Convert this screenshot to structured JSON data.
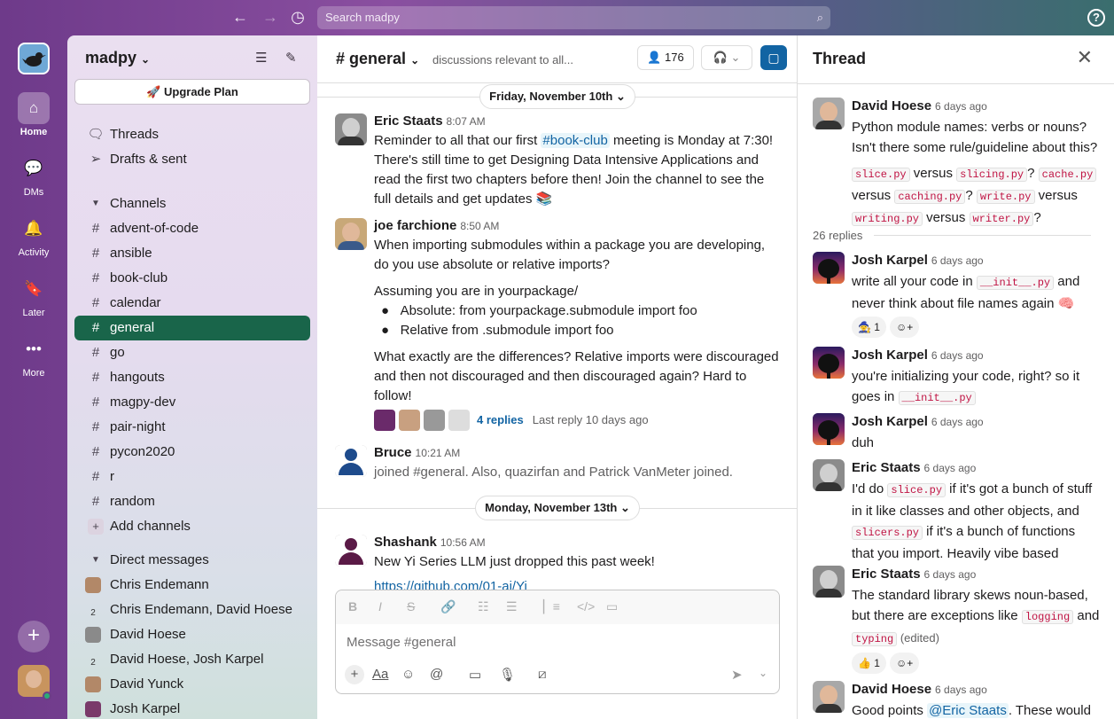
{
  "search": {
    "placeholder": "Search madpy"
  },
  "rail": {
    "items": [
      {
        "label": "Home",
        "icon": "home-icon"
      },
      {
        "label": "DMs",
        "icon": "dms-icon"
      },
      {
        "label": "Activity",
        "icon": "bell-icon"
      },
      {
        "label": "Later",
        "icon": "bookmark-icon"
      },
      {
        "label": "More",
        "icon": "more-icon"
      }
    ]
  },
  "sidebar": {
    "workspace": "madpy",
    "upgrade": "Upgrade Plan",
    "threads": "Threads",
    "drafts": "Drafts & sent",
    "channels_header": "Channels",
    "channels": [
      "advent-of-code",
      "ansible",
      "book-club",
      "calendar",
      "general",
      "go",
      "hangouts",
      "magpy-dev",
      "pair-night",
      "pycon2020",
      "r",
      "random"
    ],
    "add_channels": "Add channels",
    "dm_header": "Direct messages",
    "dms": [
      {
        "name": "Chris Endemann",
        "count": ""
      },
      {
        "name": "Chris Endemann, David Hoese",
        "count": "2"
      },
      {
        "name": "David Hoese",
        "count": ""
      },
      {
        "name": "David Hoese, Josh Karpel",
        "count": "2"
      },
      {
        "name": "David Yunck",
        "count": ""
      },
      {
        "name": "Josh Karpel",
        "count": ""
      }
    ]
  },
  "channel": {
    "name": "# general",
    "topic": "discussions relevant to all...",
    "members": "176"
  },
  "messages": {
    "day1": "Friday, November 10th",
    "day2": "Monday, November 13th",
    "m1": {
      "author": "Eric Staats",
      "time": "8:07 AM",
      "text_a": "Reminder to all that our first ",
      "mention": "#book-club",
      "text_b": " meeting is Monday at 7:30! There's still time to get Designing Data Intensive Applications and read the first two chapters before then! Join the channel to see the full details and get updates 📚"
    },
    "m2": {
      "author": "joe farchione",
      "time": "8:50 AM",
      "p1": "When importing submodules within a package you are developing, do you use absolute or relative imports?",
      "p2": "Assuming you are in yourpackage/",
      "b1": "Absolute: from yourpackage.submodule import foo",
      "b2": "Relative from .submodule import foo",
      "p3": "What exactly are the differences? Relative imports were discouraged and then not discouraged and then discouraged again? Hard to follow!",
      "replies": "4 replies",
      "last_reply": "Last reply 10 days ago"
    },
    "m3": {
      "author": "Bruce",
      "time": "10:21 AM",
      "text": "joined #general. Also, quazirfan and Patrick VanMeter joined."
    },
    "m4": {
      "author": "Shashank",
      "time": "10:56 AM",
      "text": "New Yi Series LLM just dropped this past week!",
      "link": "https://github.com/01-ai/Yi"
    }
  },
  "composer": {
    "placeholder": "Message #general"
  },
  "thread": {
    "title": "Thread",
    "replies_count": "26 replies",
    "root": {
      "author": "David Hoese",
      "time": "6 days ago",
      "text": "Python module names: verbs or nouns? Isn't there some rule/guideline about this?",
      "c1": "slice.py",
      "w1": " versus ",
      "c2": "slicing.py",
      "w2": "? ",
      "c3": "cache.py",
      "w3": " versus ",
      "c4": "caching.py",
      "w4": "? ",
      "c5": "write.py",
      "w5": " versus ",
      "c6": "writing.py",
      "w6": " versus ",
      "c7": "writer.py",
      "w7": "?"
    },
    "r1": {
      "author": "Josh Karpel",
      "time": "6 days ago",
      "a": "write all your code in ",
      "code": "__init__.py",
      "b": " and never think about file names again 🧠",
      "react": "🧙 1"
    },
    "r2": {
      "author": "Josh Karpel",
      "time": "6 days ago",
      "a": "you're initializing your code, right? so it goes in ",
      "code": "__init__.py"
    },
    "r3": {
      "author": "Josh Karpel",
      "time": "6 days ago",
      "a": "duh"
    },
    "r4": {
      "author": "Eric Staats",
      "time": "6 days ago",
      "a": "I'd do ",
      "code1": "slice.py",
      "b": " if it's got a bunch of stuff in it like classes and other objects, and ",
      "code2": "slicers.py",
      "c": " if it's a bunch of functions that you import. Heavily vibe based"
    },
    "r5": {
      "author": "Eric Staats",
      "time": "6 days ago",
      "a": "The standard library skews noun-based, but there are exceptions like ",
      "code1": "logging",
      "b": " and ",
      "code2": "typing",
      "edited": " (edited)",
      "react": "👍 1"
    },
    "r6": {
      "author": "David Hoese",
      "time": "6 days ago",
      "a": "Good points ",
      "mention": "@Eric Staats",
      "b": ". These would"
    }
  },
  "colors": {
    "accent": "#19654a",
    "link": "#1264a3",
    "code": "#c01343"
  }
}
